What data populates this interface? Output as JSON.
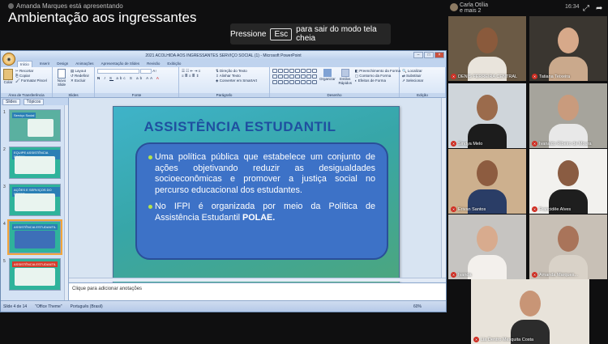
{
  "meeting": {
    "presenter_text": "Amanda Marques está apresentando",
    "title": "Ambientação aos ingressantes",
    "esc_banner": {
      "before": "Pressione",
      "key": "Esc",
      "after": "para sair do modo tela cheia"
    }
  },
  "topbar": {
    "who": "Carla Otília",
    "who_more": "e mais 2",
    "clock": "16:34"
  },
  "powerpoint": {
    "window_title": "2021 ACOLHIDA AOS INGRESSANTES SERVIÇO SOCIAL (1) - Microsoft PowerPoint",
    "tabs": [
      "Início",
      "Inserir",
      "Design",
      "Animações",
      "Apresentação de Slides",
      "Revisão",
      "Exibição"
    ],
    "groups": {
      "clipboard": {
        "name": "Área de Transferência",
        "paste": "Colar",
        "cut": "Recortar",
        "copy": "Copiar",
        "format": "Formatar Pincel"
      },
      "slides": {
        "name": "Slides",
        "new": "Novo Slide",
        "layout": "Layout",
        "reset": "Redefinir",
        "delete": "Excluir"
      },
      "font": {
        "name": "Fonte"
      },
      "paragraph": {
        "name": "Parágrafo",
        "dir": "Direção do Texto",
        "align": "Alinhar Texto",
        "smart": "Converter em SmartArt"
      },
      "drawing": {
        "name": "Desenho",
        "arrange": "Organizar",
        "styles": "Estilos Rápidos",
        "fill": "Preenchimento da Forma",
        "outline": "Contorno da Forma",
        "effects": "Efeitos de Forma"
      },
      "editing": {
        "name": "Edição",
        "find": "Localizar",
        "replace": "Substituir",
        "select": "Selecionar"
      }
    },
    "panel_tabs": [
      "Slides",
      "Tópicos"
    ],
    "thumbnails": [
      {
        "n": "1",
        "label": "Serviço Social"
      },
      {
        "n": "2",
        "label": "EQUIPE ASSISTÊNCIA SOCIAL"
      },
      {
        "n": "3",
        "label": "AÇÕES E SERVIÇOS DO SETOR"
      },
      {
        "n": "4",
        "label": "ASSISTÊNCIA ESTUDANTIL"
      },
      {
        "n": "5",
        "label": "ASSISTÊNCIA ESTUDANTIL"
      }
    ],
    "slide": {
      "title": "ASSISTÊNCIA ESTUDANTIL",
      "bullet1": "Uma política pública que estabelece um conjunto de ações objetivando reduzir as desigualdades socioeconômicas e promover a justiça social no percurso educacional dos estudantes.",
      "bullet2_text": "No IFPI é organizada por meio da Política de Assistência Estudantil ",
      "bullet2_bold": "POLAE."
    },
    "notes_placeholder": "Clique para adicionar anotações",
    "status": {
      "slide": "Slide 4 de 14",
      "theme": "\"Office Theme\"",
      "lang": "Português (Brasil)",
      "zoom": "60%"
    }
  },
  "participants": [
    {
      "name": "DENIS FERREIRA CENTRAL",
      "bg": "#6b5a45",
      "skin": "#8a5a3c",
      "shirt": "#e9e4dc"
    },
    {
      "name": "Tatiana Teixeira",
      "bg": "#3a3630",
      "skin": "#d7a98a",
      "shirt": "#caa98c"
    },
    {
      "name": "Sindya Melo",
      "bg": "#cfd5da",
      "skin": "#9b6b4c",
      "shirt": "#1c1c1c"
    },
    {
      "name": "Ivanaldo Ribeiro de Moura",
      "bg": "#a6a49c",
      "skin": "#c99b7d",
      "shirt": "#e8e8e8"
    },
    {
      "name": "Erivan Santos",
      "bg": "#cdb08e",
      "skin": "#8d5c40",
      "shirt": "#2a3d66"
    },
    {
      "name": "Francidêe Alves",
      "bg": "#f2f1ee",
      "skin": "#8a5c42",
      "shirt": "#1e1e1e"
    },
    {
      "name": "Ivanda",
      "bg": "#c6c4c1",
      "skin": "#d8ab8e",
      "shirt": "#f3f0ec"
    },
    {
      "name": "Amanda Marques...",
      "bg": "#c8c0b6",
      "skin": "#a9745a",
      "shirt": "#d9d2c8"
    },
    {
      "name": "Lia Dentro Mesquita Costa",
      "bg": "#e8e3da",
      "skin": "#c89576",
      "shirt": "#2c2c2c"
    }
  ]
}
